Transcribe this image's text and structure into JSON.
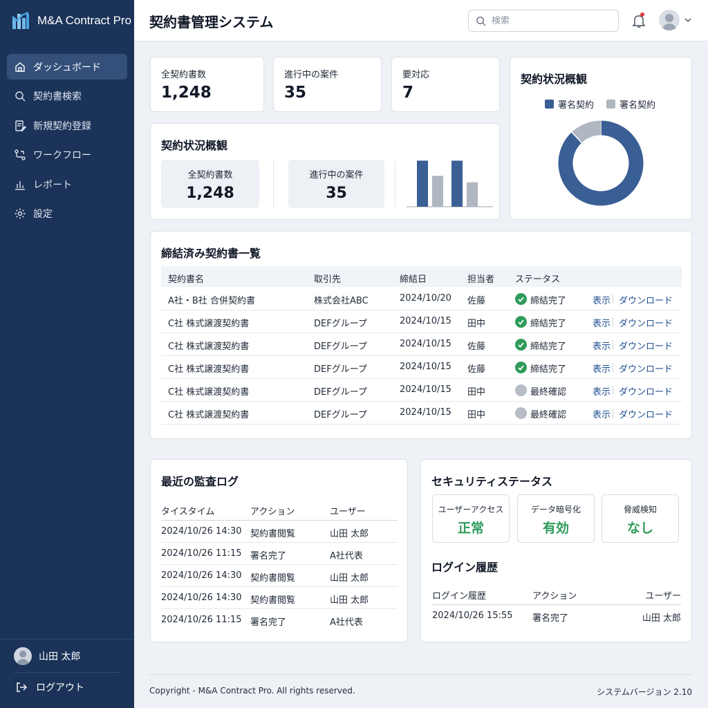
{
  "app": {
    "name": "M&A Contract Pro"
  },
  "sidebar": {
    "items": [
      {
        "label": "ダッシュボード",
        "icon": "home-icon",
        "active": true
      },
      {
        "label": "契約書検索",
        "icon": "search-icon"
      },
      {
        "label": "新規契約登録",
        "icon": "edit-document-icon"
      },
      {
        "label": "ワークフロー",
        "icon": "workflow-icon"
      },
      {
        "label": "レポート",
        "icon": "bar-chart-icon"
      },
      {
        "label": "設定",
        "icon": "gear-icon"
      }
    ],
    "user_name": "山田 太郎",
    "logout_label": "ログアウト"
  },
  "header": {
    "title": "契約書管理システム",
    "search_placeholder": "検索"
  },
  "stats": [
    {
      "label": "全契約書数",
      "value": "1,248"
    },
    {
      "label": "進行中の案件",
      "value": "35"
    },
    {
      "label": "要対応",
      "value": "7"
    }
  ],
  "overview": {
    "title": "契約状況概観",
    "mini": [
      {
        "label": "全契約書数",
        "value": "1,248"
      },
      {
        "label": "進行中の案件",
        "value": "35"
      }
    ]
  },
  "colors": {
    "primary": "#3a5f95",
    "secondary": "#b0b7c0",
    "success": "#2e9b5a",
    "sidebar": "#1b3358"
  },
  "chart_data": [
    {
      "type": "bar",
      "title": "",
      "categories": [
        "1",
        "2"
      ],
      "series": [
        {
          "values": [
            100,
            100
          ]
        },
        {
          "values": [
            67,
            53
          ]
        }
      ],
      "ylim": [
        0,
        120
      ],
      "grid": false,
      "colors": [
        "#3a5f95",
        "#b0b7c0"
      ]
    },
    {
      "type": "pie",
      "title": "契約状況概観",
      "labels": [
        "署名契約",
        "署名契約"
      ],
      "values": [
        88,
        12
      ],
      "legend": "top",
      "colors": [
        "#3a5f95",
        "#b0b7c0"
      ]
    }
  ],
  "contracts": {
    "title": "締結済み契約書一覧",
    "columns": [
      "契約書名",
      "取引先",
      "締結日",
      "担当者",
      "ステータス"
    ],
    "view_label": "表示",
    "download_label": "ダウンロード",
    "rows": [
      {
        "name": "A社・B社 合併契約書",
        "partner": "株式会社ABC",
        "date": "2024/10/20",
        "owner": "佐藤",
        "status": "締結完了",
        "done": true
      },
      {
        "name": "C社 株式譲渡契約書",
        "partner": "DEFグループ",
        "date": "2024/10/15",
        "owner": "田中",
        "status": "締結完了",
        "done": true
      },
      {
        "name": "C社 株式譲渡契約書",
        "partner": "DEFグループ",
        "date": "2024/10/15",
        "owner": "佐藤",
        "status": "締結完了",
        "done": true
      },
      {
        "name": "C社 株式譲渡契約書",
        "partner": "DEFグループ",
        "date": "2024/10/15",
        "owner": "佐藤",
        "status": "締結完了",
        "done": true
      },
      {
        "name": "C社 株式譲渡契約書",
        "partner": "DEFグループ",
        "date": "2024/10/15",
        "owner": "田中",
        "status": "最終確認",
        "done": false
      },
      {
        "name": "C社 株式譲渡契約書",
        "partner": "DEFグループ",
        "date": "2024/10/15",
        "owner": "田中",
        "status": "最終確認",
        "done": false
      }
    ]
  },
  "audit": {
    "title": "最近の監査ログ",
    "columns": [
      "タイスタイム",
      "アクション",
      "ユーザー"
    ],
    "rows": [
      [
        "2024/10/26 14:30",
        "契約書閲覧",
        "山田 太郎"
      ],
      [
        "2024/10/26 11:15",
        "署名完了",
        "A社代表"
      ],
      [
        "2024/10/26 14:30",
        "契約書閲覧",
        "山田 太郎"
      ],
      [
        "2024/10/26 14:30",
        "契約書閲覧",
        "山田 太郎"
      ],
      [
        "2024/10/26 11:15",
        "署名完了",
        "A社代表"
      ]
    ]
  },
  "security": {
    "title": "セキュリティステータス",
    "boxes": [
      {
        "label": "ユーザーアクセス",
        "value": "正常"
      },
      {
        "label": "データ暗号化",
        "value": "有効"
      },
      {
        "label": "脅威検知",
        "value": "なし"
      }
    ],
    "login_title": "ログイン履歴",
    "login_columns": [
      "ログイン履歴",
      "アクション",
      "ユーザー"
    ],
    "login_rows": [
      [
        "2024/10/26 15:55",
        "署名完了",
        "山田 太郎"
      ]
    ]
  },
  "footer": {
    "copyright": "Copyright - M&A Contract Pro. All rights reserved.",
    "version": "システムバージョン 2.10"
  }
}
